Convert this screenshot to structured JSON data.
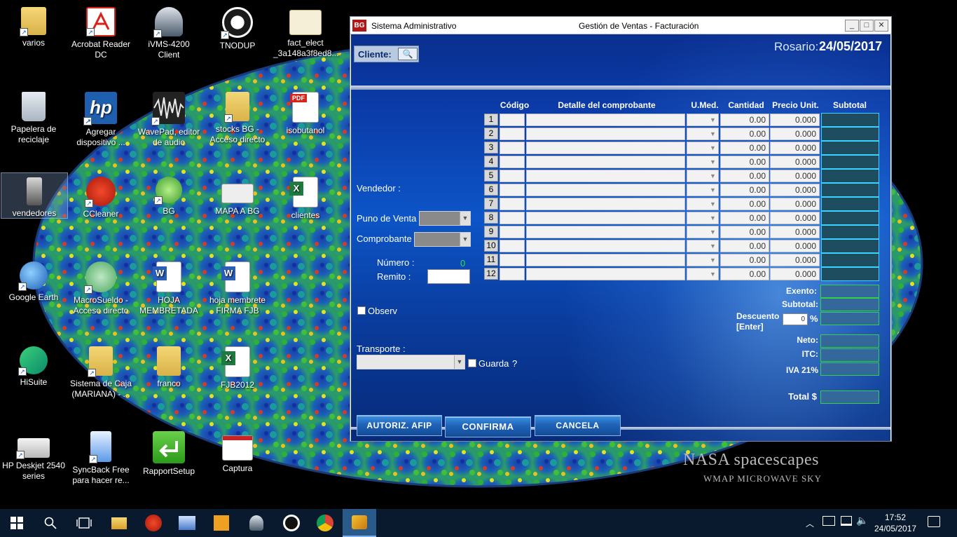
{
  "desktop": {
    "icons": [
      {
        "label": "varios"
      },
      {
        "label": "Acrobat Reader DC"
      },
      {
        "label": "iVMS-4200 Client"
      },
      {
        "label": "TNODUP"
      },
      {
        "label": "fact_elect _3a148a3f8ed8..."
      },
      {
        "label": "Papelera de reciclaje"
      },
      {
        "label": "Agregar dispositivo ..."
      },
      {
        "label": "WavePad, editor de audio"
      },
      {
        "label": "stocks BG - Acceso directo"
      },
      {
        "label": "isobutanol"
      },
      {
        "label": "vendedores"
      },
      {
        "label": "CCleaner"
      },
      {
        "label": "BG"
      },
      {
        "label": "MAPA A BG"
      },
      {
        "label": "clientes"
      },
      {
        "label": "Google Earth"
      },
      {
        "label": "MacroSueldo - Acceso directo"
      },
      {
        "label": "HOJA MEMBRETADA"
      },
      {
        "label": "hoja membrete FIRMA FJB"
      },
      {
        "label": "HiSuite"
      },
      {
        "label": "Sistema de Caja (MARIANA) - ..."
      },
      {
        "label": "franco"
      },
      {
        "label": "FJB2012"
      },
      {
        "label": "HP Deskjet 2540 series"
      },
      {
        "label": "SyncBack Free para hacer re..."
      },
      {
        "label": "RapportSetup"
      },
      {
        "label": "Captura"
      }
    ],
    "watermark_title": "NASA spacescapes",
    "watermark_sub": "WMAP MICROWAVE SKY",
    "pdf_badge": "PDF"
  },
  "window": {
    "app_name": "Sistema Administrativo",
    "title": "Gestión de Ventas - Facturación",
    "minimize": "_",
    "maximize": "□",
    "close": "✕",
    "logo": "BG",
    "cliente_label": "Cliente:",
    "location": "Rosario:",
    "date": "24/05/2017",
    "vendedor_label": "Vendedor :",
    "punto_venta_label": "Puno de Venta",
    "comprobante_label": "Comprobante",
    "numero_label": "Número :",
    "numero_value": "0",
    "remito_label": "Remito :",
    "observ_label": "Observ",
    "transporte_label": "Transporte :",
    "guarda_label": "Guarda",
    "guarda_q": "?",
    "grid": {
      "headers": [
        "Código",
        "Detalle del comprobante",
        "U.Med.",
        "Cantidad",
        "Precio Unit.",
        "Subtotal"
      ],
      "rows": [
        {
          "n": "1",
          "cantidad": "0.00",
          "precio": "0.000"
        },
        {
          "n": "2",
          "cantidad": "0.00",
          "precio": "0.000"
        },
        {
          "n": "3",
          "cantidad": "0.00",
          "precio": "0.000"
        },
        {
          "n": "4",
          "cantidad": "0.00",
          "precio": "0.000"
        },
        {
          "n": "5",
          "cantidad": "0.00",
          "precio": "0.000"
        },
        {
          "n": "6",
          "cantidad": "0.00",
          "precio": "0.000"
        },
        {
          "n": "7",
          "cantidad": "0.00",
          "precio": "0.000"
        },
        {
          "n": "8",
          "cantidad": "0.00",
          "precio": "0.000"
        },
        {
          "n": "9",
          "cantidad": "0.00",
          "precio": "0.000"
        },
        {
          "n": "10",
          "cantidad": "0.00",
          "precio": "0.000"
        },
        {
          "n": "11",
          "cantidad": "0.00",
          "precio": "0.000"
        },
        {
          "n": "12",
          "cantidad": "0.00",
          "precio": "0.000"
        }
      ]
    },
    "totals": {
      "exento": "Exento:",
      "subtotal": "Subtotal:",
      "descuento": "Descuento",
      "enter": "[Enter]",
      "descuento_value": "0",
      "percent": "%",
      "neto": "Neto:",
      "itc": "ITC:",
      "iva": "IVA 21%",
      "total": "Total $"
    },
    "buttons": {
      "autoriz": "AUTORIZ. AFIP",
      "confirma": "CONFIRMA",
      "cancela": "CANCELA"
    }
  },
  "taskbar": {
    "time": "17:52",
    "date": "24/05/2017"
  }
}
